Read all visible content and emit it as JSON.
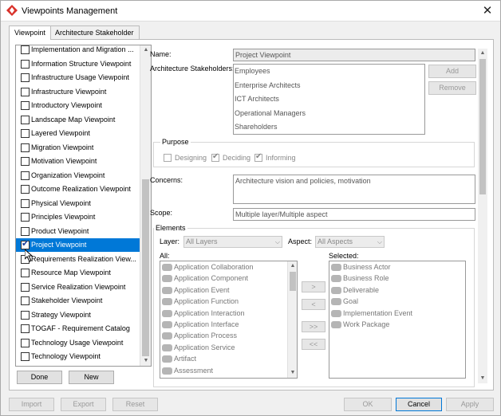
{
  "window": {
    "title": "Viewpoints Management",
    "close_glyph": "✕"
  },
  "tabs": [
    {
      "label": "Viewpoint",
      "active": true
    },
    {
      "label": "Architecture Stakeholder",
      "active": false
    }
  ],
  "viewpoint_list": {
    "items": [
      {
        "label": "Implementation and Migration ...",
        "checked": false,
        "selected": false
      },
      {
        "label": "Information Structure Viewpoint",
        "checked": false,
        "selected": false
      },
      {
        "label": "Infrastructure Usage Viewpoint",
        "checked": false,
        "selected": false
      },
      {
        "label": "Infrastructure Viewpoint",
        "checked": false,
        "selected": false
      },
      {
        "label": "Introductory Viewpoint",
        "checked": false,
        "selected": false
      },
      {
        "label": "Landscape Map Viewpoint",
        "checked": false,
        "selected": false
      },
      {
        "label": "Layered Viewpoint",
        "checked": false,
        "selected": false
      },
      {
        "label": "Migration Viewpoint",
        "checked": false,
        "selected": false
      },
      {
        "label": "Motivation Viewpoint",
        "checked": false,
        "selected": false
      },
      {
        "label": "Organization Viewpoint",
        "checked": false,
        "selected": false
      },
      {
        "label": "Outcome Realization Viewpoint",
        "checked": false,
        "selected": false
      },
      {
        "label": "Physical Viewpoint",
        "checked": false,
        "selected": false
      },
      {
        "label": "Principles Viewpoint",
        "checked": false,
        "selected": false
      },
      {
        "label": "Product Viewpoint",
        "checked": false,
        "selected": false
      },
      {
        "label": "Project Viewpoint",
        "checked": true,
        "selected": true
      },
      {
        "label": "Requirements Realization View...",
        "checked": false,
        "selected": false
      },
      {
        "label": "Resource Map Viewpoint",
        "checked": false,
        "selected": false
      },
      {
        "label": "Service Realization Viewpoint",
        "checked": false,
        "selected": false
      },
      {
        "label": "Stakeholder Viewpoint",
        "checked": false,
        "selected": false
      },
      {
        "label": "Strategy Viewpoint",
        "checked": false,
        "selected": false
      },
      {
        "label": "TOGAF - Requirement Catalog",
        "checked": false,
        "selected": false
      },
      {
        "label": "Technology Usage Viewpoint",
        "checked": false,
        "selected": false
      },
      {
        "label": "Technology Viewpoint",
        "checked": false,
        "selected": false
      }
    ],
    "check_glyph": "✔"
  },
  "list_buttons": {
    "done": "Done",
    "new": "New"
  },
  "form": {
    "name_label": "Name:",
    "name_value": "Project Viewpoint",
    "stakeholders_label": "Architecture Stakeholders:",
    "stakeholders": [
      "Employees",
      "Enterprise Architects",
      "ICT Architects",
      "Operational Managers",
      "Shareholders"
    ],
    "add_button": "Add",
    "remove_button": "Remove",
    "purpose_legend": "Purpose",
    "purpose_options": [
      {
        "label": "Designing",
        "checked": false
      },
      {
        "label": "Deciding",
        "checked": true
      },
      {
        "label": "Informing",
        "checked": true
      }
    ],
    "concerns_label": "Concerns:",
    "concerns_value": "Architecture vision and policies, motivation",
    "scope_label": "Scope:",
    "scope_value": "Multiple layer/Multiple aspect",
    "elements_legend": "Elements",
    "layer_label": "Layer:",
    "layer_value": "All Layers",
    "aspect_label": "Aspect:",
    "aspect_value": "All Aspects",
    "all_label": "All:",
    "selected_label": "Selected:",
    "all_elements": [
      "Application Collaboration",
      "Application Component",
      "Application Event",
      "Application Function",
      "Application Interaction",
      "Application Interface",
      "Application Process",
      "Application Service",
      "Artifact",
      "Assessment"
    ],
    "selected_elements": [
      "Business Actor",
      "Business Role",
      "Deliverable",
      "Goal",
      "Implementation Event",
      "Work Package"
    ],
    "move_buttons": [
      ">",
      "<",
      ">>",
      "<<"
    ]
  },
  "bottom_buttons": {
    "import": "Import",
    "export": "Export",
    "reset": "Reset",
    "ok": "OK",
    "cancel": "Cancel",
    "apply": "Apply"
  },
  "colors": {
    "selection": "#0078d7",
    "app_icon": "#d9322b"
  }
}
